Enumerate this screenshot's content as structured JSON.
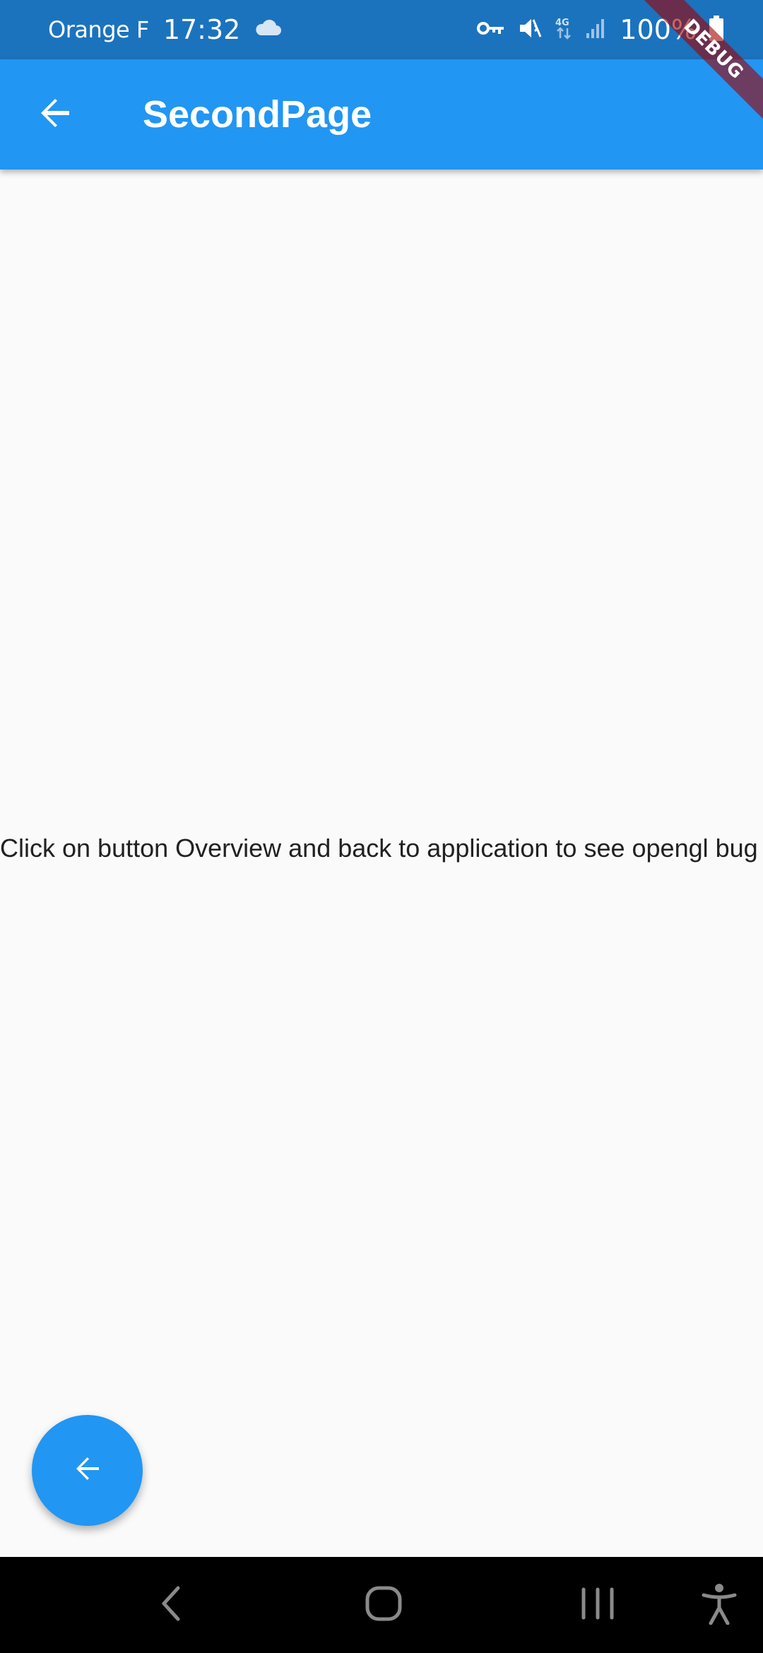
{
  "status_bar": {
    "carrier": "Orange F",
    "time": "17:32",
    "battery": "100%",
    "icons": [
      "cloud-icon",
      "vpn-key-icon",
      "mute-icon",
      "network-4g-icon",
      "signal-icon",
      "battery-icon"
    ]
  },
  "app_bar": {
    "title": "SecondPage",
    "back_icon": "arrow-back-icon"
  },
  "debug_banner": {
    "label": "DEBUG"
  },
  "body": {
    "message": "Click on button Overview and back to application to see opengl bug"
  },
  "fab": {
    "icon": "arrow-back-icon"
  },
  "nav_bar": {
    "buttons": [
      "back-icon",
      "home-icon",
      "recents-icon",
      "accessibility-icon"
    ]
  },
  "colors": {
    "status_bar": "#1b73be",
    "app_bar": "#2196f3",
    "background": "#fafafa",
    "text": "#212121",
    "nav_bar": "#000000"
  }
}
